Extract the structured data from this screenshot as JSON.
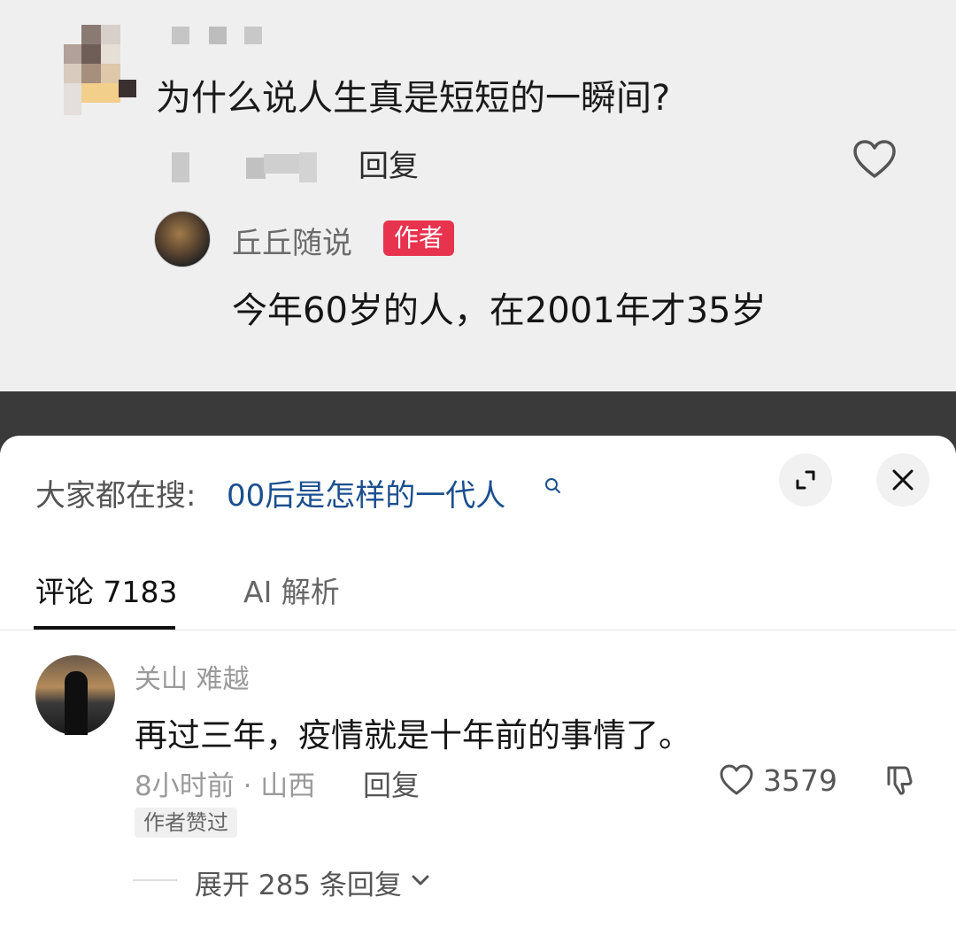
{
  "video": {
    "question": "为什么说人生真是短短的一瞬间?",
    "reply_label": "回复",
    "author": {
      "name": "丘丘随说",
      "tag": "作者",
      "comment": "今年60岁的人，在2001年才35岁"
    }
  },
  "search": {
    "prefix": "大家都在搜:",
    "term": "00后是怎样的一代人"
  },
  "tabs": [
    {
      "label": "评论 7183",
      "active": true
    },
    {
      "label": "AI 解析",
      "active": false
    }
  ],
  "comment": {
    "user": "关山  难越",
    "text": "再过三年，疫情就是十年前的事情了。",
    "meta": "8小时前 · 山西",
    "reply_label": "回复",
    "likes": "3579",
    "badge": "作者赞过"
  },
  "expand": {
    "label": "展开 285 条回复"
  },
  "icons": {
    "heart": "heart-icon",
    "dislike": "thumbs-down-icon",
    "expand": "expand-icon",
    "close": "close-icon",
    "search": "search-icon",
    "chevron": "chevron-down-icon"
  },
  "colors": {
    "author_tag": "#e8334f",
    "search_term": "#1b4f8e"
  }
}
